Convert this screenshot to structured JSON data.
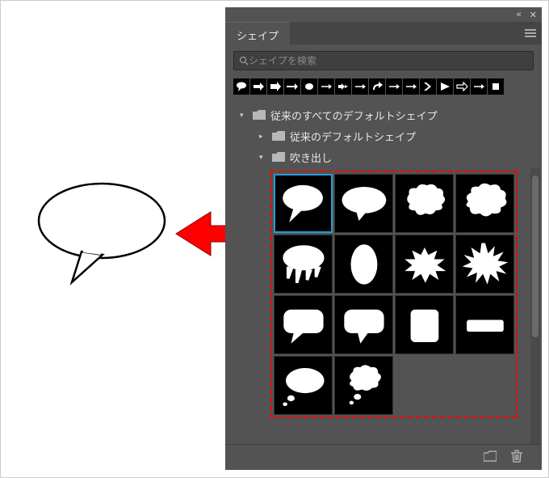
{
  "panel": {
    "title": "シェイプ",
    "search_placeholder": "シェイプを検索"
  },
  "thumbbar_icons": [
    "speech-bubble-icon",
    "arrow-block-icon",
    "arrow-solid-icon",
    "arrow-right-icon",
    "circle-icon",
    "arrow-line-icon",
    "arrow-double-icon",
    "arrow-curved-icon",
    "arrow-turn-icon",
    "arrow-line-icon",
    "arrow-line-icon",
    "chevron-icon",
    "triangle-icon",
    "arrow-outline-icon",
    "arrow-line-icon",
    "square-icon"
  ],
  "tree": {
    "root": {
      "expanded": true,
      "label": "従来のすべてのデフォルトシェイプ"
    },
    "child1": {
      "expanded": false,
      "label": "従来のデフォルトシェイプ"
    },
    "child2": {
      "expanded": true,
      "label": "吹き出し"
    }
  },
  "shapes_grid": [
    {
      "name": "speech-bubble-oval-tail",
      "selected": true
    },
    {
      "name": "speech-bubble-oval"
    },
    {
      "name": "thought-cloud-1"
    },
    {
      "name": "thought-cloud-2"
    },
    {
      "name": "speech-drip"
    },
    {
      "name": "oval-vertical"
    },
    {
      "name": "burst-wide"
    },
    {
      "name": "burst-spiky"
    },
    {
      "name": "rounded-rect-tail"
    },
    {
      "name": "rounded-rect-tail-2"
    },
    {
      "name": "rounded-rect"
    },
    {
      "name": "bar-horizontal"
    },
    {
      "name": "oval-small-tail"
    },
    {
      "name": "thought-bubble-trail"
    },
    {
      "name": "empty",
      "empty": true
    },
    {
      "name": "empty",
      "empty": true
    }
  ],
  "footer": {
    "new_folder_label": "新規フォルダー",
    "delete_label": "削除"
  },
  "colors": {
    "highlight": "#1e9fd8",
    "dashed_border": "#ff0000",
    "panel_bg": "#535353"
  }
}
